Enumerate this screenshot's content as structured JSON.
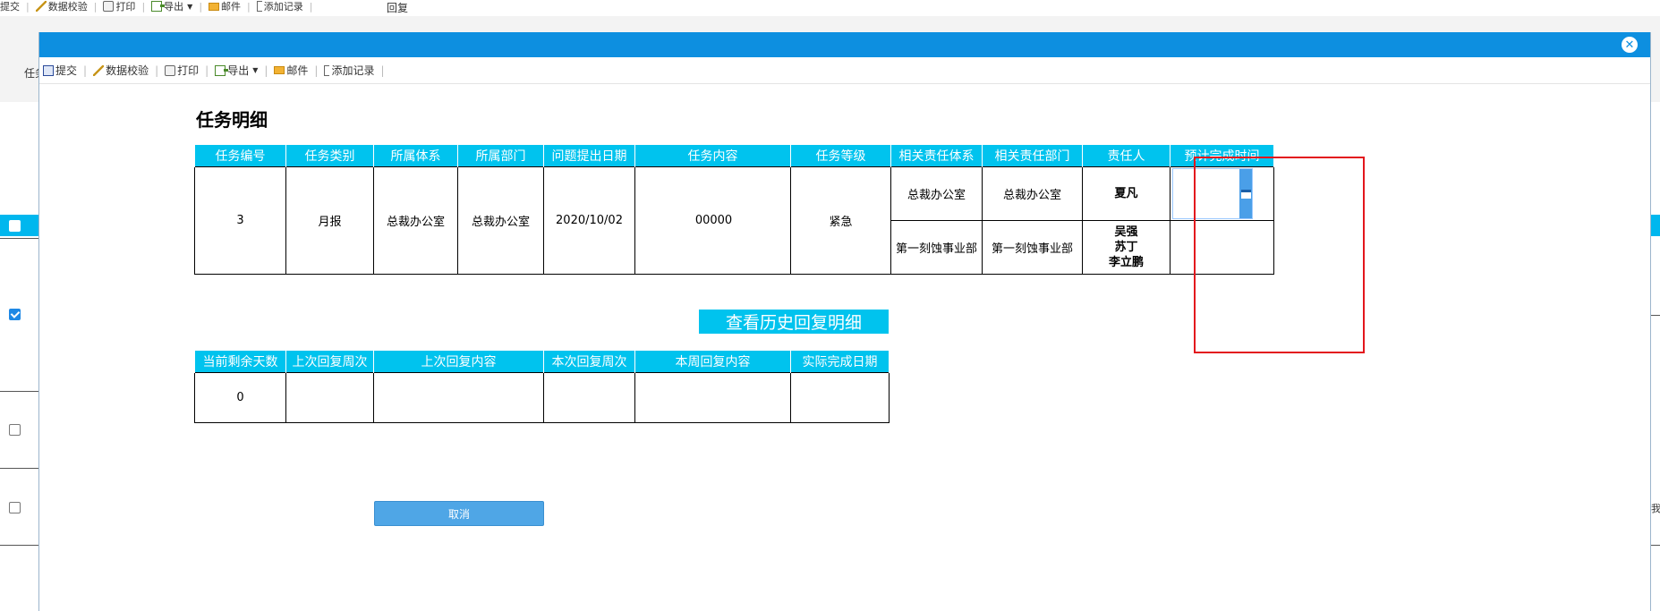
{
  "background": {
    "toolbar": {
      "items": [
        "提交",
        "数据校验",
        "打印",
        "导出",
        "邮件",
        "添加记录"
      ]
    },
    "reply_label": "回复",
    "left_label": "任务",
    "right_edge_label": "我",
    "rows": [
      {
        "checked": true
      },
      {
        "checked": false
      },
      {
        "checked": false
      }
    ]
  },
  "modal": {
    "toolbar": {
      "items": [
        "提交",
        "数据校验",
        "打印",
        "导出",
        "邮件",
        "添加记录"
      ]
    },
    "close_symbol": "✕",
    "title": "任务明细",
    "task_table": {
      "headers": [
        "任务编号",
        "任务类别",
        "所属体系",
        "所属部门",
        "问题提出日期",
        "任务内容",
        "任务等级",
        "相关责任体系",
        "相关责任部门",
        "责任人",
        "预计完成时间"
      ],
      "row": {
        "number": "3",
        "category": "月报",
        "system": "总裁办公室",
        "department": "总裁办公室",
        "date": "2020/10/02",
        "content": "00000",
        "level": "紧急",
        "sub_rows": [
          {
            "resp_system": "总裁办公室",
            "resp_department": "总裁办公室",
            "person": [
              "夏凡"
            ]
          },
          {
            "resp_system": "第一刻蚀事业部",
            "resp_department": "第一刻蚀事业部",
            "person": [
              "吴强",
              "苏丁",
              "李立鹏"
            ]
          }
        ],
        "expected_completion": ""
      }
    },
    "history_button": "查看历史回复明细",
    "reply_table": {
      "headers": [
        "当前剩余天数",
        "上次回复周次",
        "上次回复内容",
        "本次回复周次",
        "本周回复内容",
        "实际完成日期"
      ],
      "row": [
        "0",
        "",
        "",
        "",
        "",
        ""
      ]
    },
    "cancel_button": "取消"
  },
  "colors": {
    "header_cyan": "#00c3ee",
    "modal_blue": "#0d8fe0",
    "highlight_red": "#e3161d",
    "button_blue": "#4fa6e6"
  }
}
